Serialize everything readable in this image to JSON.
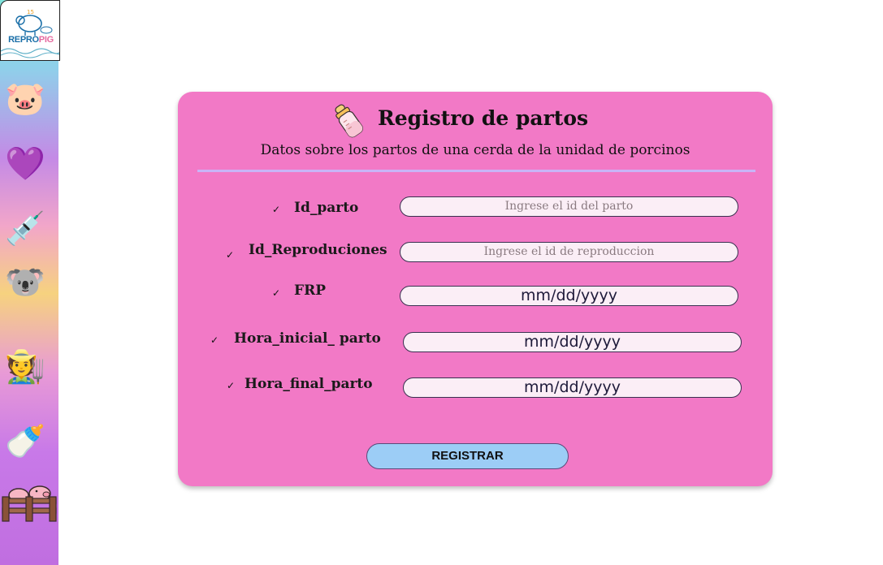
{
  "logo": {
    "text_a": "REPRO",
    "text_b": "PIG"
  },
  "sidebar": {
    "items": [
      {
        "icon": "pig-face-icon",
        "glyph": "🐷"
      },
      {
        "icon": "purple-heart-icon",
        "glyph": "💜"
      },
      {
        "icon": "syringe-icon",
        "glyph": "💉"
      },
      {
        "icon": "koala-icon",
        "glyph": "🐨"
      },
      {
        "icon": "farmer-icon",
        "glyph": "🧑‍🌾"
      },
      {
        "icon": "baby-bottle-icon",
        "glyph": "🍼"
      }
    ],
    "pen_icon": "pig-pen-icon"
  },
  "form": {
    "title": "Registro de partos",
    "subtitle": "Datos sobre los partos de una cerda de la unidad de porcinos",
    "check": "✓",
    "fields": [
      {
        "label": "Id_parto",
        "placeholder": "Ingrese el id del parto"
      },
      {
        "label": "Id_Reproduciones",
        "placeholder": "Ingrese el id de reproduccion"
      },
      {
        "label": "FRP",
        "value": "mm/dd/yyyy"
      },
      {
        "label": "Hora_inicial_ parto",
        "value": "mm/dd/yyyy"
      },
      {
        "label": "Hora_final_parto",
        "value": "mm/dd/yyyy"
      }
    ],
    "submit_label": "REGISTRAR"
  },
  "colors": {
    "card": "#f279c6",
    "button": "#9ccdf6",
    "divider": "#c9b4f7",
    "input_bg": "#fbeef6"
  }
}
